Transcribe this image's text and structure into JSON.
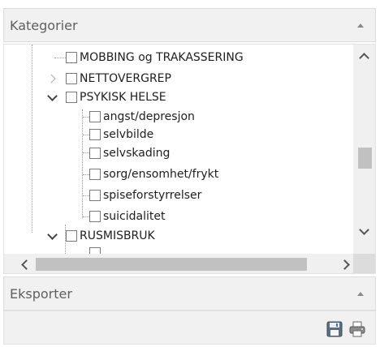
{
  "panels": {
    "categories_title": "Kategorier",
    "export_title": "Eksporter"
  },
  "tree": {
    "items": [
      {
        "label": "MOBBING og TRAKASSERING",
        "level": 1,
        "expander": "none"
      },
      {
        "label": "NETTOVERGREP",
        "level": 1,
        "expander": "collapsed"
      },
      {
        "label": "PSYKISK HELSE",
        "level": 1,
        "expander": "expanded"
      },
      {
        "label": "angst/depresjon",
        "level": 2,
        "expander": "none"
      },
      {
        "label": "selvbilde",
        "level": 2,
        "expander": "none"
      },
      {
        "label": "selvskading",
        "level": 2,
        "expander": "none"
      },
      {
        "label": "sorg/ensomhet/frykt",
        "level": 2,
        "expander": "none"
      },
      {
        "label": "spiseforstyrrelser",
        "level": 2,
        "expander": "none"
      },
      {
        "label": "suicidalitet",
        "level": 2,
        "expander": "none"
      },
      {
        "label": "RUSMISBRUK",
        "level": 1,
        "expander": "expanded"
      }
    ]
  },
  "icons": {
    "collapse": "chevron-up-icon",
    "save": "floppy-disk-icon",
    "print": "printer-icon"
  },
  "colors": {
    "panel_header_bg": "#f1f1f1",
    "scrollbar_thumb": "#c1c1c1"
  }
}
